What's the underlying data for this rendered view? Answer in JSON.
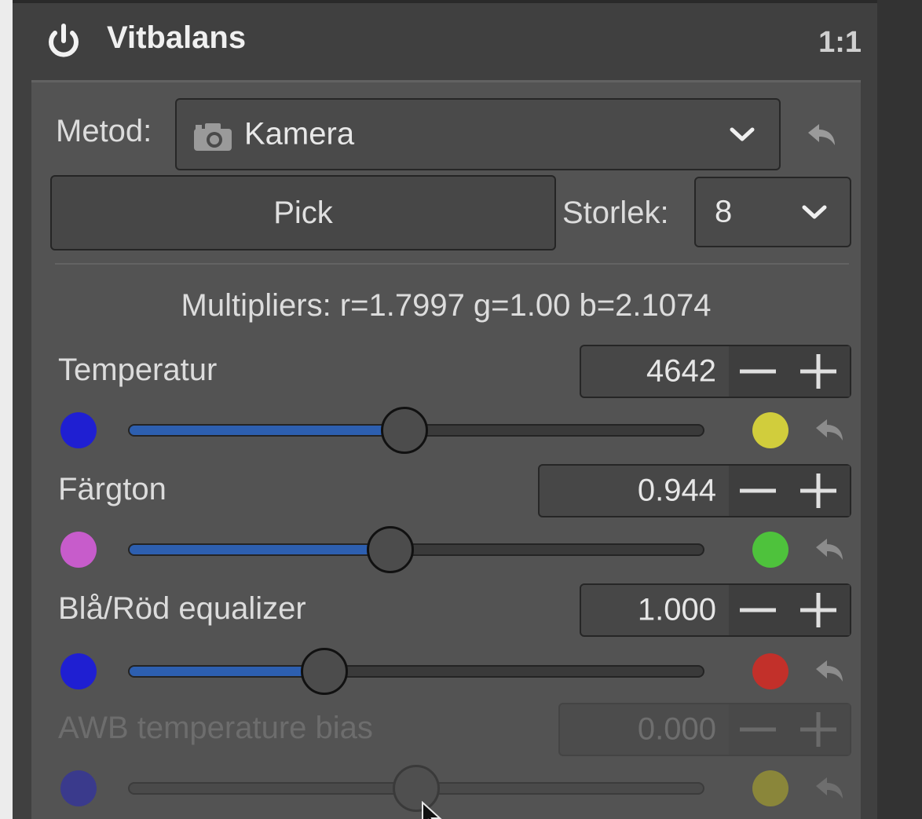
{
  "header": {
    "title": "Vitbalans",
    "zoom": "1:1"
  },
  "method": {
    "label": "Metod:",
    "value": "Kamera",
    "icon": "camera-icon"
  },
  "pick": {
    "button_label": "Pick",
    "size_label": "Storlek:",
    "size_value": "8"
  },
  "multipliers": "Multipliers: r=1.7997 g=1.00 b=2.1074",
  "sliders": [
    {
      "label": "Temperatur",
      "value": "4642",
      "enabled": true,
      "position_fraction": 0.48,
      "left_color": "#1f1fd2",
      "right_color": "#d1cd3c"
    },
    {
      "label": "Färgton",
      "value": "0.944",
      "enabled": true,
      "position_fraction": 0.455,
      "left_color": "#c75ccb",
      "right_color": "#4ec23c"
    },
    {
      "label": "Blå/Röd equalizer",
      "value": "1.000",
      "enabled": true,
      "position_fraction": 0.34,
      "left_color": "#1f1fd2",
      "right_color": "#c2302a"
    },
    {
      "label": "AWB temperature bias",
      "value": "0.000",
      "enabled": false,
      "position_fraction": 0.5,
      "left_color": "#3a3a8c",
      "right_color": "#8a863a"
    }
  ],
  "colors": {
    "accent": "#2d5fb0",
    "panel_bg": "#535353",
    "header_bg": "#404040"
  }
}
